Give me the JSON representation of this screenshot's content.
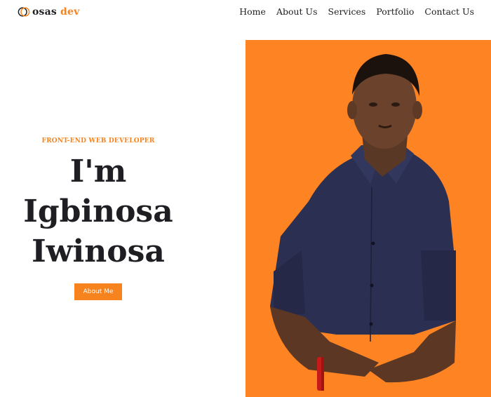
{
  "logo": {
    "brand_word": "osas",
    "accent_word": "dev",
    "accent_color": "#f7831f",
    "icon": "circle-logo-icon"
  },
  "nav": {
    "items": [
      {
        "label": "Home"
      },
      {
        "label": "About Us"
      },
      {
        "label": "Services"
      },
      {
        "label": "Portfolio"
      },
      {
        "label": "Contact Us"
      }
    ]
  },
  "hero": {
    "subtitle": "FRONT-END WEB DEVELOPER",
    "title_lines": [
      "I'm",
      "Igbinosa",
      "Iwinosa"
    ],
    "cta_label": "About Me"
  },
  "colors": {
    "accent": "#f7831f",
    "portrait_bg": "#fd8323",
    "text": "#1f1f23"
  }
}
